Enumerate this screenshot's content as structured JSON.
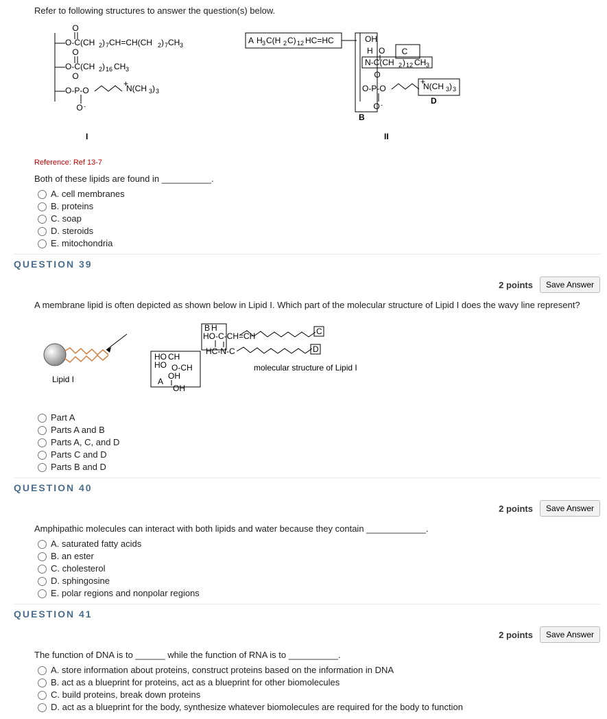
{
  "intro": "Refer to following structures to answer the question(s) below.",
  "reference": "Reference: Ref 13-7",
  "structure": {
    "label_I": "I",
    "label_II": "II",
    "box_A": "A",
    "box_B": "B",
    "box_C": "C",
    "box_D": "D",
    "line1": "O-C(CH2)7CH=CH(CH2)7CH3",
    "line2": "O-C(CH2)16CH3",
    "line3": "O-P-O",
    "nch": "N(CH3)3",
    "right1": "H3C(H2C)12HC=HC",
    "right_OH": "OH",
    "right_C": "N-C(CH2)12CH3",
    "o": "O",
    "o_minus": "O-"
  },
  "q38": {
    "text": "Both of these lipids are found in __________.",
    "opts": [
      "A. cell membranes",
      "B. proteins",
      "C. soap",
      "D. steroids",
      "E. mitochondria"
    ]
  },
  "q39": {
    "header": "QUESTION 39",
    "points": "2 points",
    "save": "Save Answer",
    "text": "A membrane lipid is often depicted as shown below in Lipid I. Which part of the molecular structure of Lipid I does the wavy line represent?",
    "fig_left": "Lipid I",
    "fig_right": "molecular structure of Lipid I",
    "opts": [
      "Part A",
      "Parts A and B",
      "Parts A, C, and D",
      "Parts C and D",
      "Parts B and D"
    ],
    "lbl_A": "A",
    "lbl_B": "B",
    "lbl_C": "C",
    "lbl_D": "D",
    "lbl_H": "H",
    "chem_hoc": "HO-C-CH=CH",
    "chem_hcn": "HC-N-C",
    "chem_ho": "HO",
    "chem_ch": "CH",
    "chem_och": "O-CH",
    "chem_oh": "OH"
  },
  "q40": {
    "header": "QUESTION 40",
    "points": "2 points",
    "save": "Save Answer",
    "text": "Amphipathic molecules can interact with both lipids and water because they contain ____________.",
    "opts": [
      "A. saturated fatty acids",
      "B. an ester",
      "C. cholesterol",
      "D. sphingosine",
      "E. polar regions and nonpolar regions"
    ]
  },
  "q41": {
    "header": "QUESTION 41",
    "points": "2 points",
    "save": "Save Answer",
    "text": "The function of DNA is to ______ while the function of RNA is to __________.",
    "opts": [
      "A. store information about proteins, construct proteins based on the information in DNA",
      "B. act as a blueprint for proteins, act as a blueprint for other biomolecules",
      "C. build proteins, break down proteins",
      "D. act as a blueprint for the body, synthesize whatever biomolecules are required for the body to function"
    ]
  }
}
